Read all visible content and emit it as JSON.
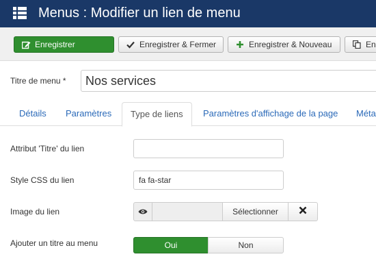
{
  "header": {
    "title": "Menus : Modifier un lien de menu",
    "background": "#1a3867",
    "menu_icon": "list-icon"
  },
  "toolbar": {
    "save_label": "Enregistrer",
    "save_close_label": "Enregistrer & Fermer",
    "save_new_label": "Enregistrer & Nouveau",
    "save_copy_label": "En",
    "save_icon": "edit-icon",
    "save_close_icon": "check-icon",
    "save_new_icon": "plus-icon",
    "save_copy_icon": "copy-icon",
    "success_color": "#2f8f2f"
  },
  "menu_title": {
    "label": "Titre de menu *",
    "value": "Nos services"
  },
  "tabs": [
    {
      "label": "Détails"
    },
    {
      "label": "Paramètres"
    },
    {
      "label": "Type de liens",
      "active": true
    },
    {
      "label": "Paramètres d'affichage de la page"
    },
    {
      "label": "Méta"
    }
  ],
  "form": {
    "title_attr_label": "Attribut 'Titre' du lien",
    "title_attr_value": "",
    "css_label": "Style CSS du lien",
    "css_value": "fa fa-star",
    "image_label": "Image du lien",
    "image_icon": "eye-icon",
    "image_select_label": "Sélectionner",
    "image_clear_icon": "close-icon",
    "menu_title_label": "Ajouter un titre au menu",
    "toggle_yes": "Oui",
    "toggle_no": "Non",
    "toggle_selected": "Oui"
  },
  "link_color": "#2a69b8"
}
